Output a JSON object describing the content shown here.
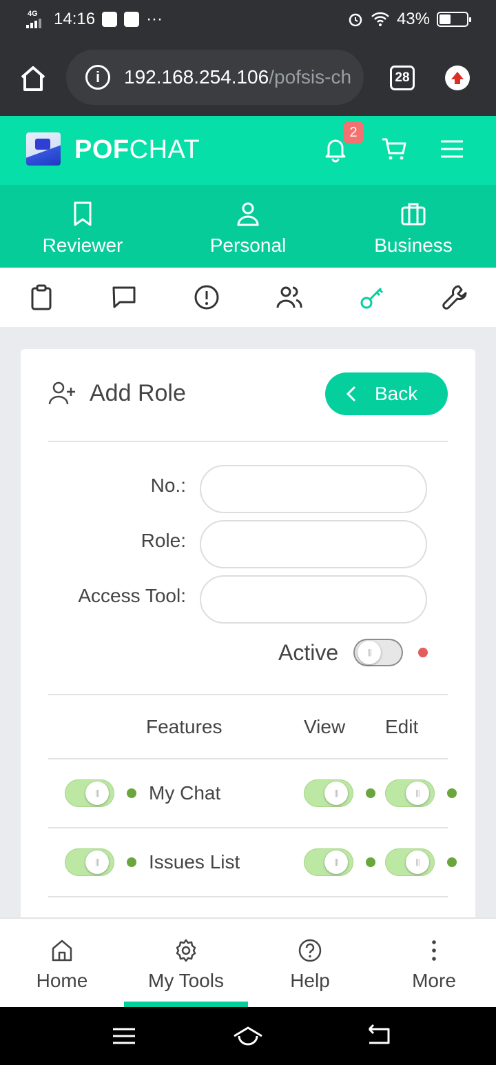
{
  "status_bar": {
    "network": "4G",
    "time": "14:16",
    "more": "···",
    "battery": "43%"
  },
  "browser": {
    "url_host": "192.168.254.106",
    "url_path": "/pofsis-ch",
    "tab_count": "28"
  },
  "app": {
    "brand_bold": "POF",
    "brand_rest": "CHAT",
    "notification_count": "2",
    "brand_color": "#06dfa8"
  },
  "categories": [
    {
      "label": "Reviewer",
      "icon": "bookmark-icon"
    },
    {
      "label": "Personal",
      "icon": "user-icon"
    },
    {
      "label": "Business",
      "icon": "briefcase-icon"
    }
  ],
  "toolbar": {
    "items": [
      "clipboard-icon",
      "chat-icon",
      "alert-icon",
      "users-icon",
      "key-icon",
      "wrench-icon"
    ],
    "active": "key-icon",
    "active_color": "#06cf9e"
  },
  "card": {
    "title": "Add Role",
    "back_label": "Back",
    "fields": {
      "no_label": "No.:",
      "no_value": "",
      "role_label": "Role:",
      "role_value": "",
      "access_label": "Access Tool:",
      "access_value": ""
    },
    "active_label": "Active",
    "active_on": false,
    "table_headers": {
      "features": "Features",
      "view": "View",
      "edit": "Edit"
    },
    "features": [
      {
        "name": "My Chat",
        "enabled": true,
        "view": true,
        "edit": true
      },
      {
        "name": "Issues List",
        "enabled": true,
        "view": true,
        "edit": true
      }
    ]
  },
  "bottom_nav": {
    "items": [
      {
        "label": "Home",
        "icon": "home-icon"
      },
      {
        "label": "My Tools",
        "icon": "gear-icon"
      },
      {
        "label": "Help",
        "icon": "help-icon"
      },
      {
        "label": "More",
        "icon": "more-vertical-icon"
      }
    ],
    "active": "My Tools"
  }
}
